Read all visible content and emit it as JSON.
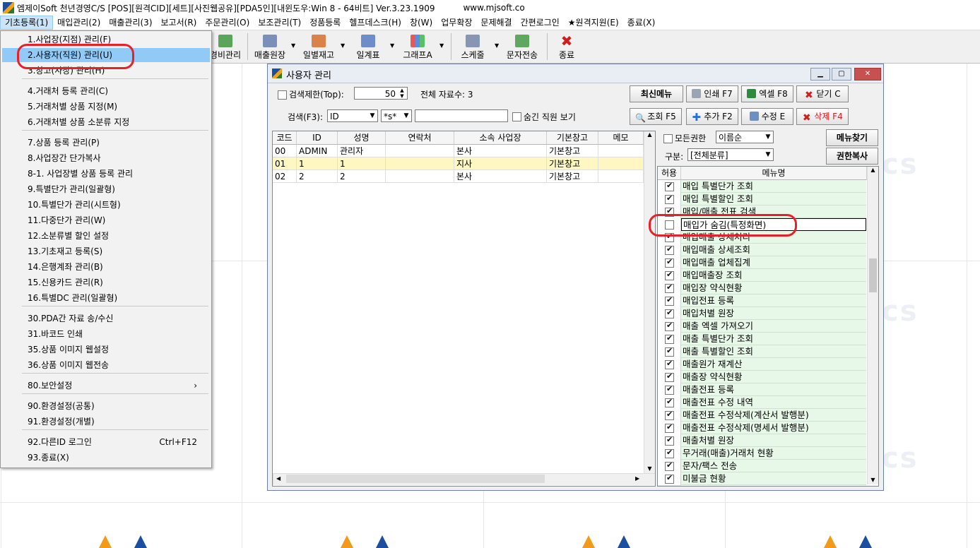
{
  "titlebar": {
    "title": "엠제이Soft 천년경영C/S [POS][원격CID][세트][사진웹공유][PDA5인][내윈도우:Win 8 - 64비트] Ver.3.23.1909",
    "url": "www.mjsoft.co"
  },
  "menubar": [
    "기초등록(1)",
    "매입관리(2)",
    "매출관리(3)",
    "보고서(R)",
    "주문관리(O)",
    "보조관리(T)",
    "정품등록",
    "헬프데스크(H)",
    "창(W)",
    "업무확장",
    "문제해결",
    "간편로그인",
    "★원격지원(E)",
    "종료(X)"
  ],
  "toolbar": {
    "partial_label": "경비관리",
    "buttons": [
      "매출원장",
      "일별재고",
      "일계표",
      "그래프A",
      "스케줄",
      "문자전송",
      "종료"
    ]
  },
  "dropdown": {
    "items": [
      {
        "label": "1.사업장(지점) 관리(F)",
        "shortcut": ""
      },
      {
        "label": "2.사용자(직원) 관리(U)",
        "shortcut": ""
      },
      {
        "label": "3.창고(사장) 관리(H)",
        "shortcut": ""
      },
      {
        "label": "4.거래처 등록 관리(C)",
        "shortcut": ""
      },
      {
        "label": "5.거래처별 상품 지정(M)",
        "shortcut": ""
      },
      {
        "label": "6.거래처별 상품 소분류 지정",
        "shortcut": ""
      },
      {
        "label": "7.상품 등록 관리(P)",
        "shortcut": ""
      },
      {
        "label": "8.사업장간 단가복사",
        "shortcut": ""
      },
      {
        "label": "8-1. 사업장별 상품 등록 관리",
        "shortcut": ""
      },
      {
        "label": "9.특별단가 관리(일괄형)",
        "shortcut": ""
      },
      {
        "label": "10.특별단가 관리(시트형)",
        "shortcut": ""
      },
      {
        "label": "11.다중단가 관리(W)",
        "shortcut": ""
      },
      {
        "label": "12.소분류별 할인 설정",
        "shortcut": ""
      },
      {
        "label": "13.기초재고 등록(S)",
        "shortcut": ""
      },
      {
        "label": "14.은행계좌 관리(B)",
        "shortcut": ""
      },
      {
        "label": "15.신용카드 관리(R)",
        "shortcut": ""
      },
      {
        "label": "16.특별DC 관리(일괄형)",
        "shortcut": ""
      },
      {
        "label": "30.PDA간 자료 송/수신",
        "shortcut": ""
      },
      {
        "label": "31.바코드 인쇄",
        "shortcut": ""
      },
      {
        "label": "35.상품 이미지 웹설정",
        "shortcut": ""
      },
      {
        "label": "36.상품 이미지 웹전송",
        "shortcut": ""
      },
      {
        "label": "80.보안설정",
        "shortcut": "›"
      },
      {
        "label": "90.환경설정(공통)",
        "shortcut": ""
      },
      {
        "label": "91.환경설정(개별)",
        "shortcut": ""
      },
      {
        "label": "92.다른ID 로그인",
        "shortcut": "Ctrl+F12"
      },
      {
        "label": "93.종료(X)",
        "shortcut": ""
      }
    ]
  },
  "window": {
    "title": "사용자 관리",
    "search_limit_label": "검색제한(Top):",
    "search_limit_value": "50",
    "total_label": "전체 자료수: 3",
    "btn_recent": "최신메뉴",
    "btn_print": "인쇄 F7",
    "btn_excel": "엑셀 F8",
    "btn_close": "닫기 C",
    "search_label": "검색(F3):",
    "search_field": "ID",
    "search_mode": "*s*",
    "search_value": "",
    "hidden_staff_label": "숨긴 직원 보기",
    "btn_query": "조회 F5",
    "btn_add": "추가 F2",
    "btn_edit": "수정 E",
    "btn_delete": "삭제 F4",
    "all_perm_label": "모든권한",
    "sort_value": "이름순",
    "btn_find_menu": "메뉴찾기",
    "category_label": "구분:",
    "category_value": "[전체분류]",
    "btn_copy_perm": "권한복사"
  },
  "users_table": {
    "columns": [
      "코드",
      "ID",
      "성명",
      "연락처",
      "소속 사업장",
      "기본창고",
      "메모"
    ],
    "rows": [
      [
        "00",
        "ADMIN",
        "관리자",
        "",
        "본사",
        "기본창고",
        ""
      ],
      [
        "01",
        "1",
        "1",
        "",
        "지사",
        "기본창고",
        ""
      ],
      [
        "02",
        "2",
        "2",
        "",
        "본사",
        "기본창고",
        ""
      ]
    ]
  },
  "perm_table": {
    "columns": [
      "허용",
      "메뉴명"
    ],
    "rows": [
      {
        "name": "매입 특별단가 조회",
        "allowed": true
      },
      {
        "name": "매입 특별할인 조회",
        "allowed": true
      },
      {
        "name": "매입/매출 전표 검색",
        "allowed": true
      },
      {
        "name": "매입가 숨김(특정화면)",
        "allowed": false
      },
      {
        "name": "매입매출 상세처리",
        "allowed": true
      },
      {
        "name": "매입매출 상세조회",
        "allowed": true
      },
      {
        "name": "매입매출 업체집계",
        "allowed": true
      },
      {
        "name": "매입매출장 조회",
        "allowed": true
      },
      {
        "name": "매입장 약식현황",
        "allowed": true
      },
      {
        "name": "매입전표 등록",
        "allowed": true
      },
      {
        "name": "매입처별 원장",
        "allowed": true
      },
      {
        "name": "매출 엑셀 가져오기",
        "allowed": true
      },
      {
        "name": "매출 특별단가 조회",
        "allowed": true
      },
      {
        "name": "매출 특별할인 조회",
        "allowed": true
      },
      {
        "name": "매출원가 재계산",
        "allowed": true
      },
      {
        "name": "매출장 약식현황",
        "allowed": true
      },
      {
        "name": "매출전표 등록",
        "allowed": true
      },
      {
        "name": "매출전표 수정 내역",
        "allowed": true
      },
      {
        "name": "매출전표 수정삭제(계산서 발행분)",
        "allowed": true
      },
      {
        "name": "매출전표 수정삭제(명세서 발행분)",
        "allowed": true
      },
      {
        "name": "매출처별 원장",
        "allowed": true
      },
      {
        "name": "무거래(매출)거래처 현황",
        "allowed": true
      },
      {
        "name": "문자/팩스 전송",
        "allowed": true
      },
      {
        "name": "미불금 현황",
        "allowed": true
      }
    ]
  },
  "watermark": "cs",
  "colors": {
    "highlight": "#91c9f7",
    "annotation": "#e8202a",
    "perm_row_bg": "#e8f8e8",
    "selected_row_bg": "#fff7c2"
  }
}
